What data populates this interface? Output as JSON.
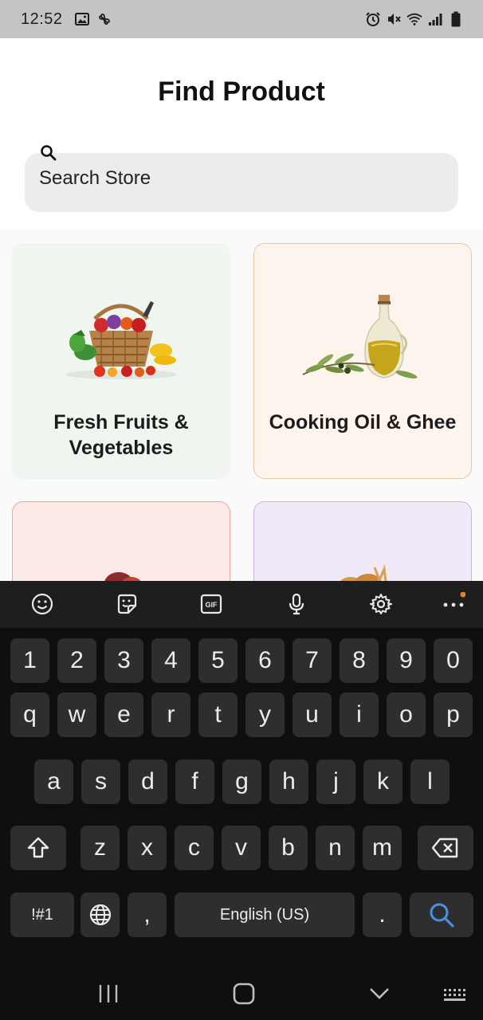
{
  "status_bar": {
    "time": "12:52",
    "left_icons": [
      "image-icon",
      "pinwheel-icon"
    ],
    "right_icons": [
      "alarm-icon",
      "mute-icon",
      "wifi-icon",
      "signal-icon",
      "battery-icon"
    ]
  },
  "header": {
    "title": "Find Product",
    "search": {
      "placeholder": "Search Store",
      "icon": "search-icon"
    }
  },
  "categories": [
    {
      "label": "Fresh Fruits & Vegetables",
      "bg": "#eef6ef",
      "border": "#eef6ef",
      "icon": "fruit-basket-image"
    },
    {
      "label": "Cooking Oil & Ghee",
      "bg": "#fdf5ed",
      "border": "#e9c7a0",
      "icon": "oil-bottle-image"
    },
    {
      "label": "",
      "bg": "#fbe9e6",
      "border": "#e9a79d",
      "icon": "meat-image"
    },
    {
      "label": "",
      "bg": "#f1e9f7",
      "border": "#cfb2e0",
      "icon": "bakery-image"
    }
  ],
  "keyboard": {
    "toolbar": [
      "emoji-icon",
      "sticker-icon",
      "gif-icon",
      "microphone-icon",
      "settings-icon",
      "more-icon"
    ],
    "gif_label": "GIF",
    "row_numbers": [
      "1",
      "2",
      "3",
      "4",
      "5",
      "6",
      "7",
      "8",
      "9",
      "0"
    ],
    "row_top": [
      "q",
      "w",
      "e",
      "r",
      "t",
      "y",
      "u",
      "i",
      "o",
      "p"
    ],
    "row_middle": [
      "a",
      "s",
      "d",
      "f",
      "g",
      "h",
      "j",
      "k",
      "l"
    ],
    "row_bottom": [
      "z",
      "x",
      "c",
      "v",
      "b",
      "n",
      "m"
    ],
    "symbols_label": "!#1",
    "comma": ",",
    "space_label": "English (US)",
    "period": ".",
    "accent_color": "#4a8fe6"
  },
  "nav_bar": {
    "buttons": [
      "recents-icon",
      "home-icon",
      "back-icon",
      "keyboard-switch-icon"
    ]
  }
}
